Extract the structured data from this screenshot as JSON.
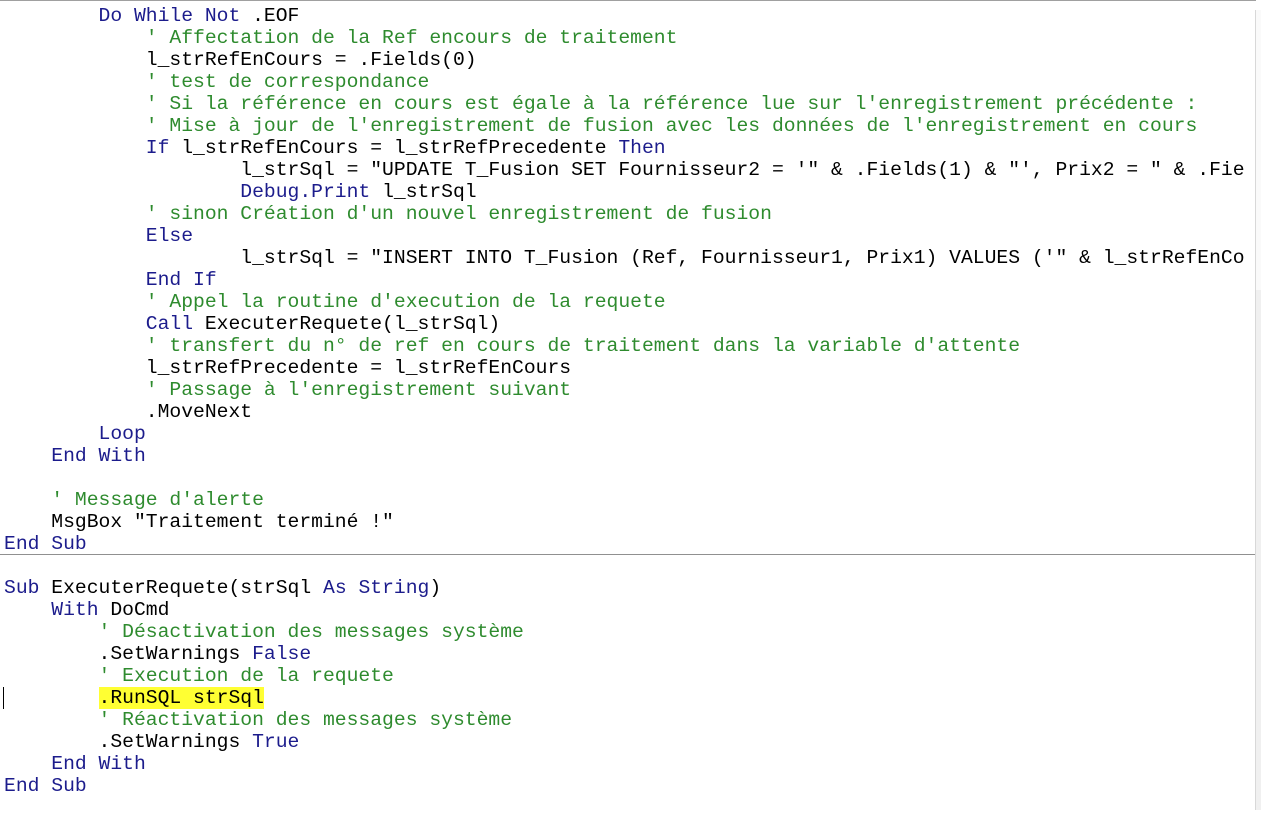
{
  "colors": {
    "keyword": "#1c1c8c",
    "comment": "#2e8b2e",
    "text": "#000000",
    "highlight": "#ffff33"
  },
  "code": {
    "lines": [
      [
        [
          "kw",
          "        Do While Not"
        ],
        [
          "t",
          " .EOF"
        ]
      ],
      [
        [
          "cm",
          "            ' Affectation de la Ref encours de traitement"
        ]
      ],
      [
        [
          "t",
          "            l_strRefEnCours = .Fields(0)"
        ]
      ],
      [
        [
          "cm",
          "            ' test de correspondance"
        ]
      ],
      [
        [
          "cm",
          "            ' Si la référence en cours est égale à la référence lue sur l'enregistrement précédente :"
        ]
      ],
      [
        [
          "cm",
          "            ' Mise à jour de l'enregistrement de fusion avec les données de l'enregistrement en cours"
        ]
      ],
      [
        [
          "kw",
          "            If"
        ],
        [
          "t",
          " l_strRefEnCours = l_strRefPrecedente "
        ],
        [
          "kw",
          "Then"
        ]
      ],
      [
        [
          "t",
          "                    l_strSql = \"UPDATE T_Fusion SET Fournisseur2 = '\" & .Fields(1) & \"', Prix2 = \" & .Fie"
        ]
      ],
      [
        [
          "kw",
          "                    Debug.Print"
        ],
        [
          "t",
          " l_strSql"
        ]
      ],
      [
        [
          "cm",
          "            ' sinon Création d'un nouvel enregistrement de fusion"
        ]
      ],
      [
        [
          "kw",
          "            Else"
        ]
      ],
      [
        [
          "t",
          "                    l_strSql = \"INSERT INTO T_Fusion (Ref, Fournisseur1, Prix1) VALUES ('\" & l_strRefEnCo"
        ]
      ],
      [
        [
          "kw",
          "            End If"
        ]
      ],
      [
        [
          "cm",
          "            ' Appel la routine d'execution de la requete"
        ]
      ],
      [
        [
          "kw",
          "            Call"
        ],
        [
          "t",
          " ExecuterRequete(l_strSql)"
        ]
      ],
      [
        [
          "cm",
          "            ' transfert du n° de ref en cours de traitement dans la variable d'attente"
        ]
      ],
      [
        [
          "t",
          "            l_strRefPrecedente = l_strRefEnCours"
        ]
      ],
      [
        [
          "cm",
          "            ' Passage à l'enregistrement suivant"
        ]
      ],
      [
        [
          "t",
          "            .MoveNext"
        ]
      ],
      [
        [
          "kw",
          "        Loop"
        ]
      ],
      [
        [
          "kw",
          "    End With"
        ]
      ],
      [],
      [
        [
          "cm",
          "    ' Message d'alerte"
        ]
      ],
      [
        [
          "t",
          "    MsgBox \"Traitement terminé !\""
        ]
      ],
      [
        [
          "kw",
          "End Sub"
        ]
      ],
      "separator",
      [],
      [
        [
          "kw",
          "Sub"
        ],
        [
          "t",
          " ExecuterRequete(strSql "
        ],
        [
          "kw",
          "As String"
        ],
        [
          "t",
          ")"
        ]
      ],
      [
        [
          "kw",
          "    With"
        ],
        [
          "t",
          " DoCmd"
        ]
      ],
      [
        [
          "cm",
          "        ' Désactivation des messages système"
        ]
      ],
      [
        [
          "t",
          "        .SetWarnings "
        ],
        [
          "kw",
          "False"
        ]
      ],
      [
        [
          "cm",
          "        ' Execution de la requete"
        ]
      ],
      [
        [
          "t",
          "        "
        ],
        [
          "hl",
          ".RunSQL strSql"
        ]
      ],
      [
        [
          "cm",
          "        ' Réactivation des messages système"
        ]
      ],
      [
        [
          "t",
          "        .SetWarnings "
        ],
        [
          "kw",
          "True"
        ]
      ],
      [
        [
          "kw",
          "    End With"
        ]
      ],
      [
        [
          "kw",
          "End Sub"
        ]
      ]
    ]
  }
}
